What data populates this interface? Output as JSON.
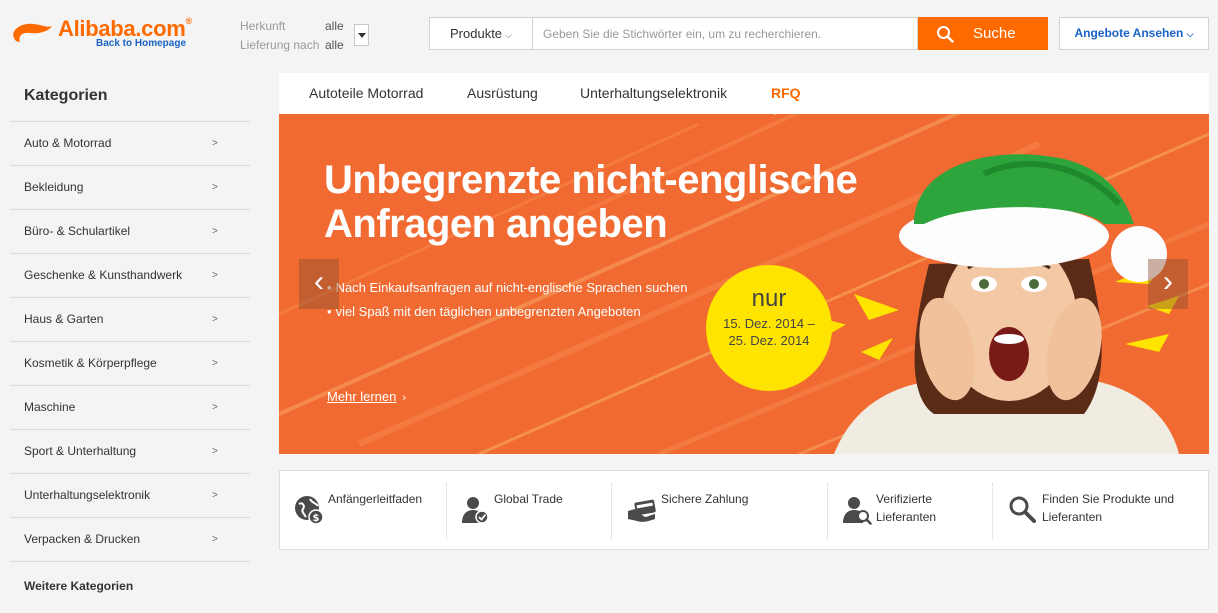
{
  "header": {
    "logo_text": "Alibaba.com",
    "logo_reg": "®",
    "logo_sub": "Back to Homepage",
    "origin_label": "Herkunft",
    "origin_value": "alle",
    "delivery_label": "Lieferung nach",
    "delivery_value": "alle",
    "search_category": "Produkte",
    "search_placeholder": "Geben Sie die Stichwörter ein, um zu recherchieren.",
    "search_button": "Suche",
    "offers_button": "Angebote Ansehen",
    "accent_color": "#ff6a00",
    "link_color": "#1a63c4"
  },
  "sidebar": {
    "title": "Kategorien",
    "items": [
      {
        "label": "Auto & Motorrad",
        "arrow": ">"
      },
      {
        "label": "Bekleidung",
        "arrow": ">"
      },
      {
        "label": "Büro- & Schulartikel",
        "arrow": ">"
      },
      {
        "label": "Geschenke & Kunsthandwerk",
        "arrow": ">"
      },
      {
        "label": "Haus & Garten",
        "arrow": ">"
      },
      {
        "label": "Kosmetik & Körperpflege",
        "arrow": ">"
      },
      {
        "label": "Maschine",
        "arrow": ">"
      },
      {
        "label": "Sport & Unterhaltung",
        "arrow": ">"
      },
      {
        "label": "Unterhaltungselektronik",
        "arrow": ">"
      },
      {
        "label": "Verpacken & Drucken",
        "arrow": ">"
      }
    ],
    "more": "Weitere Kategorien"
  },
  "tabs": [
    {
      "label": "Autoteile Motorrad",
      "active": false
    },
    {
      "label": "Ausrüstung",
      "active": false
    },
    {
      "label": "Unterhaltungselektronik",
      "active": false
    },
    {
      "label": "RFQ",
      "active": true
    }
  ],
  "banner": {
    "title_line1": "Unbegrenzte nicht-englische",
    "title_line2": "Anfragen angeben",
    "bullets": [
      "Nach Einkaufsanfragen auf nicht-englische Sprachen suchen",
      "viel Spaß mit den täglichen unbegrenzten Angeboten"
    ],
    "more_link": "Mehr lernen",
    "badge_word": "nur",
    "badge_date1": "15. Dez. 2014 –",
    "badge_date2": "25. Dez. 2014",
    "bg_color": "#f06a31",
    "badge_color": "#ffe400",
    "prev_arrow": "‹",
    "next_arrow": "›"
  },
  "features": [
    {
      "label": "Anfängerleitfaden",
      "icon": "globe-dollar-icon"
    },
    {
      "label": "Global Trade",
      "icon": "user-check-icon"
    },
    {
      "label": "Sichere Zahlung",
      "icon": "card-hand-icon"
    },
    {
      "label_line1": "Verifizierte",
      "label_line2": "Lieferanten",
      "icon": "user-search-icon"
    },
    {
      "label_line1": "Finden Sie Produkte und",
      "label_line2": "Lieferanten",
      "icon": "magnifier-icon"
    }
  ]
}
